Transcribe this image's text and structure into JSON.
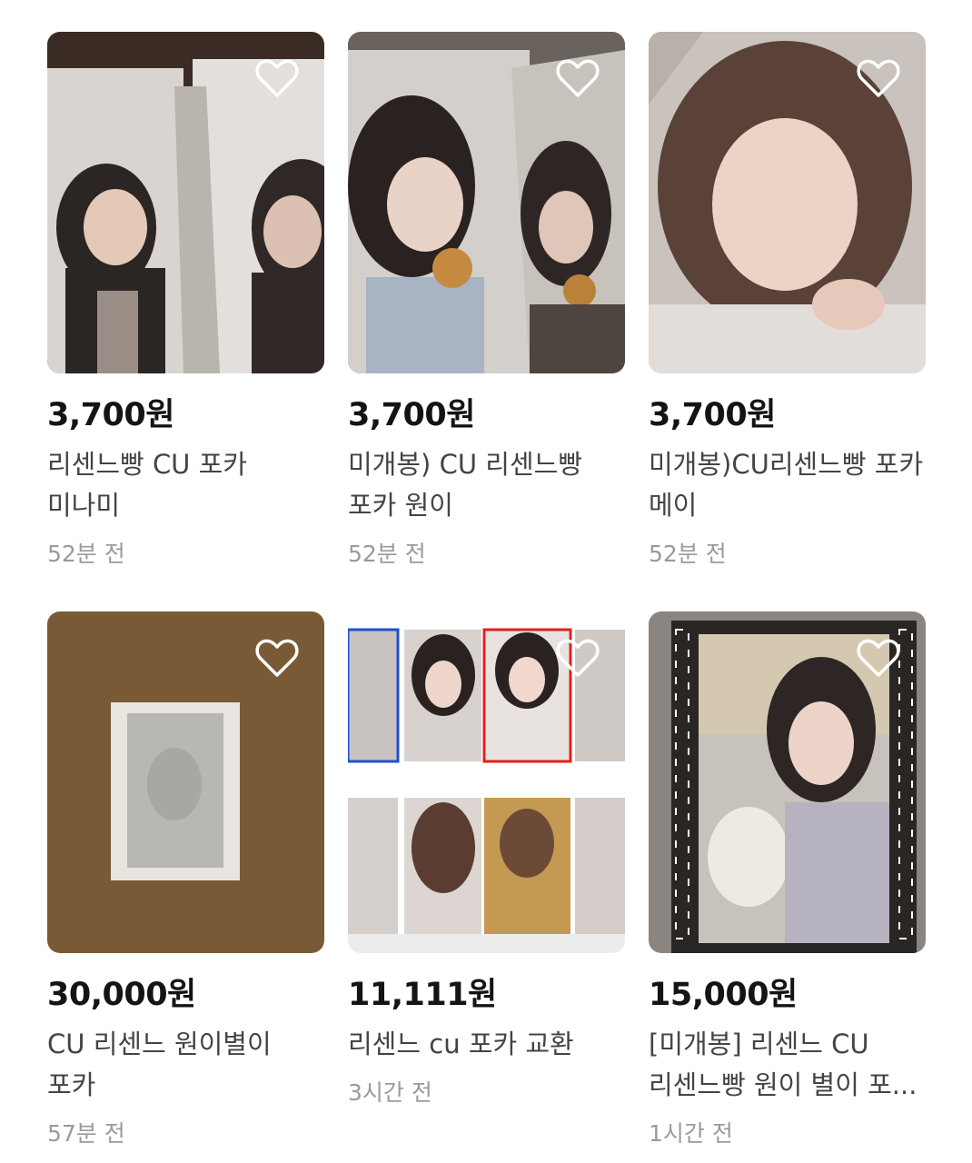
{
  "listings": [
    {
      "price": "3,700원",
      "title": "리센느빵 CU 포카 미나미",
      "time": "52분 전",
      "liked": false,
      "thumb_icon": "photo-card-image"
    },
    {
      "price": "3,700원",
      "title": "미개봉) CU 리센느빵 포카 원이",
      "time": "52분 전",
      "liked": false,
      "thumb_icon": "photo-card-image"
    },
    {
      "price": "3,700원",
      "title": "미개봉)CU리센느빵 포카 메이",
      "time": "52분 전",
      "liked": false,
      "thumb_icon": "photo-card-image"
    },
    {
      "price": "30,000원",
      "title": "CU 리센느 원이별이 포카",
      "time": "57분 전",
      "liked": false,
      "thumb_icon": "photo-card-image"
    },
    {
      "price": "11,111원",
      "title": "리센느 cu 포카 교환",
      "time": "3시간 전",
      "liked": false,
      "thumb_icon": "photo-card-image"
    },
    {
      "price": "15,000원",
      "title": "[미개봉] 리센느 CU 리센느빵 원이 별이 포...",
      "time": "1시간 전",
      "liked": false,
      "thumb_icon": "photo-card-image"
    }
  ],
  "colors": {
    "price": "#141414",
    "title": "#444444",
    "time": "#9a9a9a",
    "heart_outline": "#ffffff"
  }
}
